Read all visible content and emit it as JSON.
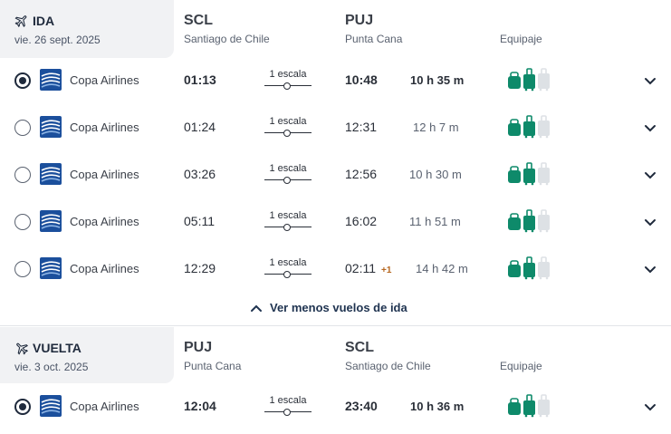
{
  "ida": {
    "title": "IDA",
    "date": "vie. 26 sept. 2025",
    "origin_code": "SCL",
    "origin_city": "Santiago de Chile",
    "dest_code": "PUJ",
    "dest_city": "Punta Cana",
    "equip_label": "Equipaje",
    "flights": [
      {
        "airline": "Copa Airlines",
        "dep": "01:13",
        "stops": "1 escala",
        "arr": "10:48",
        "plus": "",
        "duration": "10 h 35 m",
        "selected": true
      },
      {
        "airline": "Copa Airlines",
        "dep": "01:24",
        "stops": "1 escala",
        "arr": "12:31",
        "plus": "",
        "duration": "12 h 7 m",
        "selected": false
      },
      {
        "airline": "Copa Airlines",
        "dep": "03:26",
        "stops": "1 escala",
        "arr": "12:56",
        "plus": "",
        "duration": "10 h 30 m",
        "selected": false
      },
      {
        "airline": "Copa Airlines",
        "dep": "05:11",
        "stops": "1 escala",
        "arr": "16:02",
        "plus": "",
        "duration": "11 h 51 m",
        "selected": false
      },
      {
        "airline": "Copa Airlines",
        "dep": "12:29",
        "stops": "1 escala",
        "arr": "02:11",
        "plus": "+1",
        "duration": "14 h 42 m",
        "selected": false
      }
    ],
    "less_label": "Ver menos vuelos de ida"
  },
  "vuelta": {
    "title": "VUELTA",
    "date": "vie. 3 oct. 2025",
    "origin_code": "PUJ",
    "origin_city": "Punta Cana",
    "dest_code": "SCL",
    "dest_city": "Santiago de Chile",
    "equip_label": "Equipaje",
    "flights": [
      {
        "airline": "Copa Airlines",
        "dep": "12:04",
        "stops": "1 escala",
        "arr": "23:40",
        "plus": "",
        "duration": "10 h 36 m",
        "selected": true
      }
    ]
  },
  "colors": {
    "bag_included": "#0e8a6a",
    "bag_excluded": "#dde1e5",
    "text_dark": "#1f2a3c"
  },
  "icons": {
    "plane_out": "plane-icon",
    "plane_back": "plane-icon",
    "chevron": "chevron-down-icon",
    "less": "chevron-up-icon",
    "baggage": "baggage-icons"
  }
}
